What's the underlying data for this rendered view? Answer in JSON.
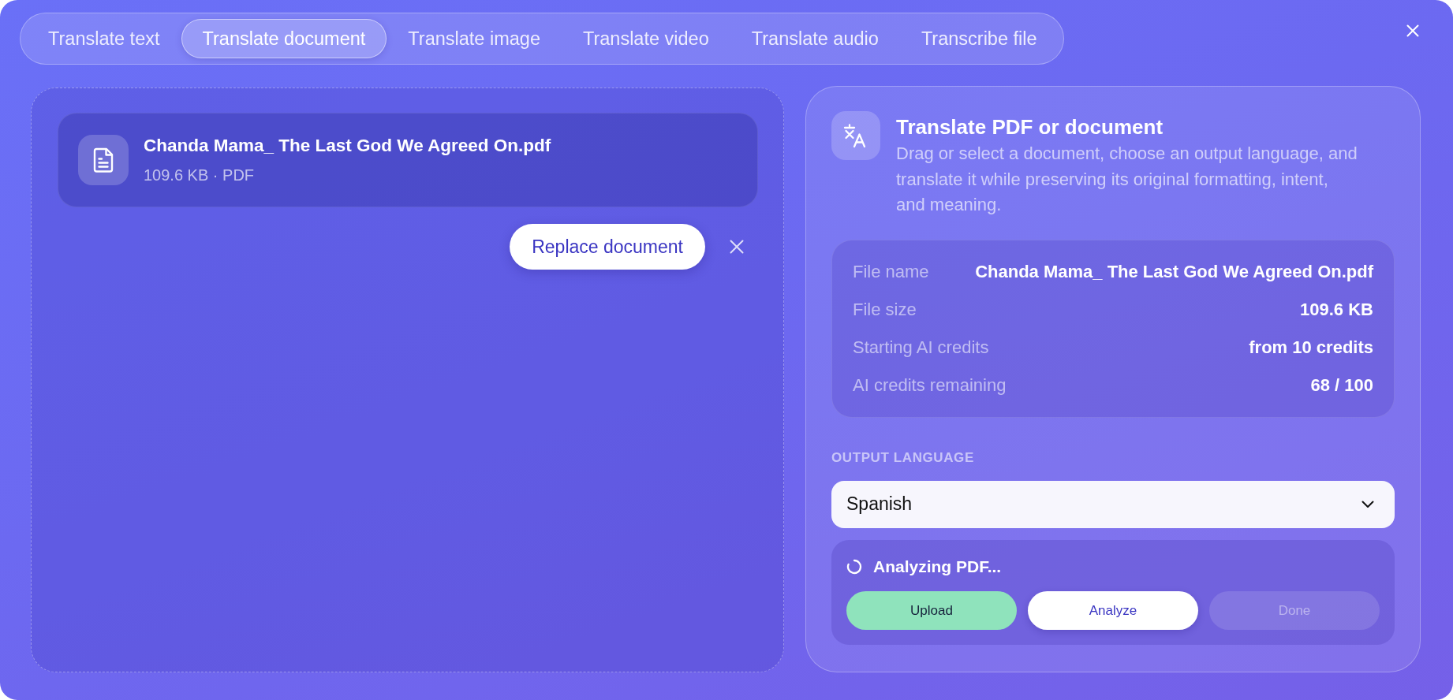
{
  "tabs": [
    {
      "label": "Translate text",
      "selected": false
    },
    {
      "label": "Translate document",
      "selected": true
    },
    {
      "label": "Translate image",
      "selected": false
    },
    {
      "label": "Translate video",
      "selected": false
    },
    {
      "label": "Translate audio",
      "selected": false
    },
    {
      "label": "Transcribe file",
      "selected": false
    }
  ],
  "upload_area": {
    "file": {
      "name": "Chanda Mama_ The Last God We Agreed On.pdf",
      "meta": "109.6 KB · PDF"
    },
    "replace_button": "Replace document"
  },
  "details_panel": {
    "title": "Translate PDF or document",
    "description": "Drag or select a document, choose an output language, and translate it while preserving its original formatting, intent, and meaning.",
    "info": [
      {
        "label": "File name",
        "value": "Chanda Mama_ The Last God We Agreed On.pdf"
      },
      {
        "label": "File size",
        "value": "109.6 KB"
      },
      {
        "label": "Starting AI credits",
        "value": "from 10 credits"
      },
      {
        "label": "AI credits remaining",
        "value": "68 / 100"
      }
    ],
    "output_language": {
      "label": "OUTPUT LANGUAGE",
      "value": "Spanish"
    },
    "progress": {
      "status": "Analyzing PDF...",
      "steps": [
        {
          "label": "Upload",
          "completed": true,
          "current": false
        },
        {
          "label": "Analyze",
          "completed": false,
          "current": true
        },
        {
          "label": "Done",
          "completed": false,
          "current": false
        }
      ]
    }
  }
}
